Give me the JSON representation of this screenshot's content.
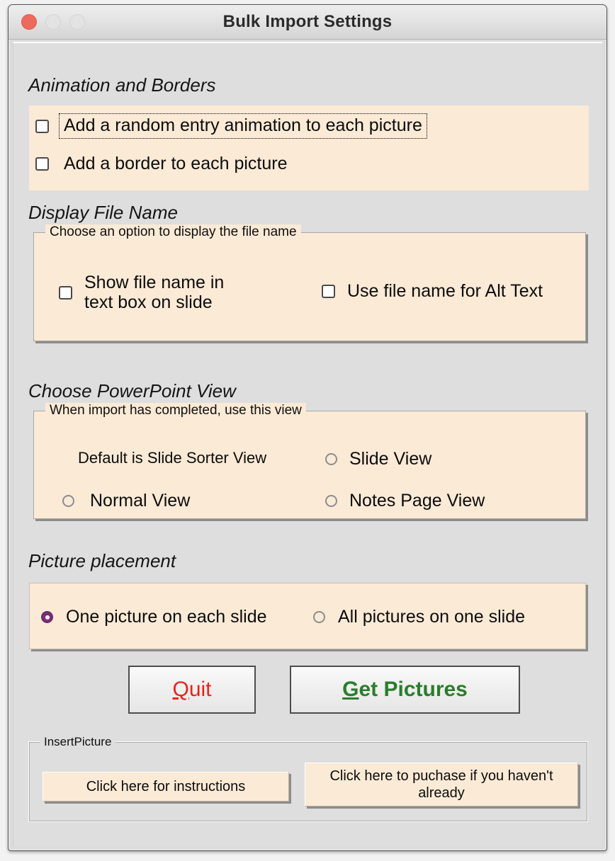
{
  "window": {
    "title": "Bulk Import Settings",
    "traffic_lights": [
      "close",
      "minimize",
      "maximize"
    ]
  },
  "colors": {
    "window_bg": "#dedede",
    "panel_cream": "#fbead6",
    "radio_selected": "#7b2d7b",
    "quit_text": "#e8231b",
    "get_pictures_text": "#2b7d2b",
    "close_button": "#ef6a5d",
    "shadow": "#8c8c8c"
  },
  "sections": {
    "animation": {
      "heading": "Animation and Borders",
      "checkboxes": [
        {
          "label": "Add a random entry animation to each picture",
          "checked": false,
          "focused": true
        },
        {
          "label": "Add a border to each picture",
          "checked": false,
          "focused": false
        }
      ]
    },
    "display_file_name": {
      "heading": "Display File Name",
      "legend": "Choose an option to display the file name",
      "checkboxes": [
        {
          "label": "Show file name in text box on slide",
          "checked": false
        },
        {
          "label": "Use file name for Alt Text",
          "checked": false
        }
      ]
    },
    "powerpoint_view": {
      "heading": "Choose PowerPoint View",
      "legend": "When import has completed, use this view",
      "note": "Default is Slide Sorter View",
      "radios": [
        {
          "label": "Slide View",
          "checked": false
        },
        {
          "label": "Normal View",
          "checked": false
        },
        {
          "label": "Notes Page View",
          "checked": false
        }
      ]
    },
    "picture_placement": {
      "heading": "Picture placement",
      "radios": [
        {
          "label": "One picture on each slide",
          "checked": true
        },
        {
          "label": "All pictures on one slide",
          "checked": false
        }
      ]
    }
  },
  "buttons": {
    "quit": {
      "accel": "Q",
      "rest": "uit"
    },
    "get_pictures": {
      "accel": "G",
      "rest": "et Pictures"
    }
  },
  "footer": {
    "legend": "InsertPicture",
    "instructions_button": "Click here for instructions",
    "purchase_button": "Click here to puchase if you haven't already"
  }
}
